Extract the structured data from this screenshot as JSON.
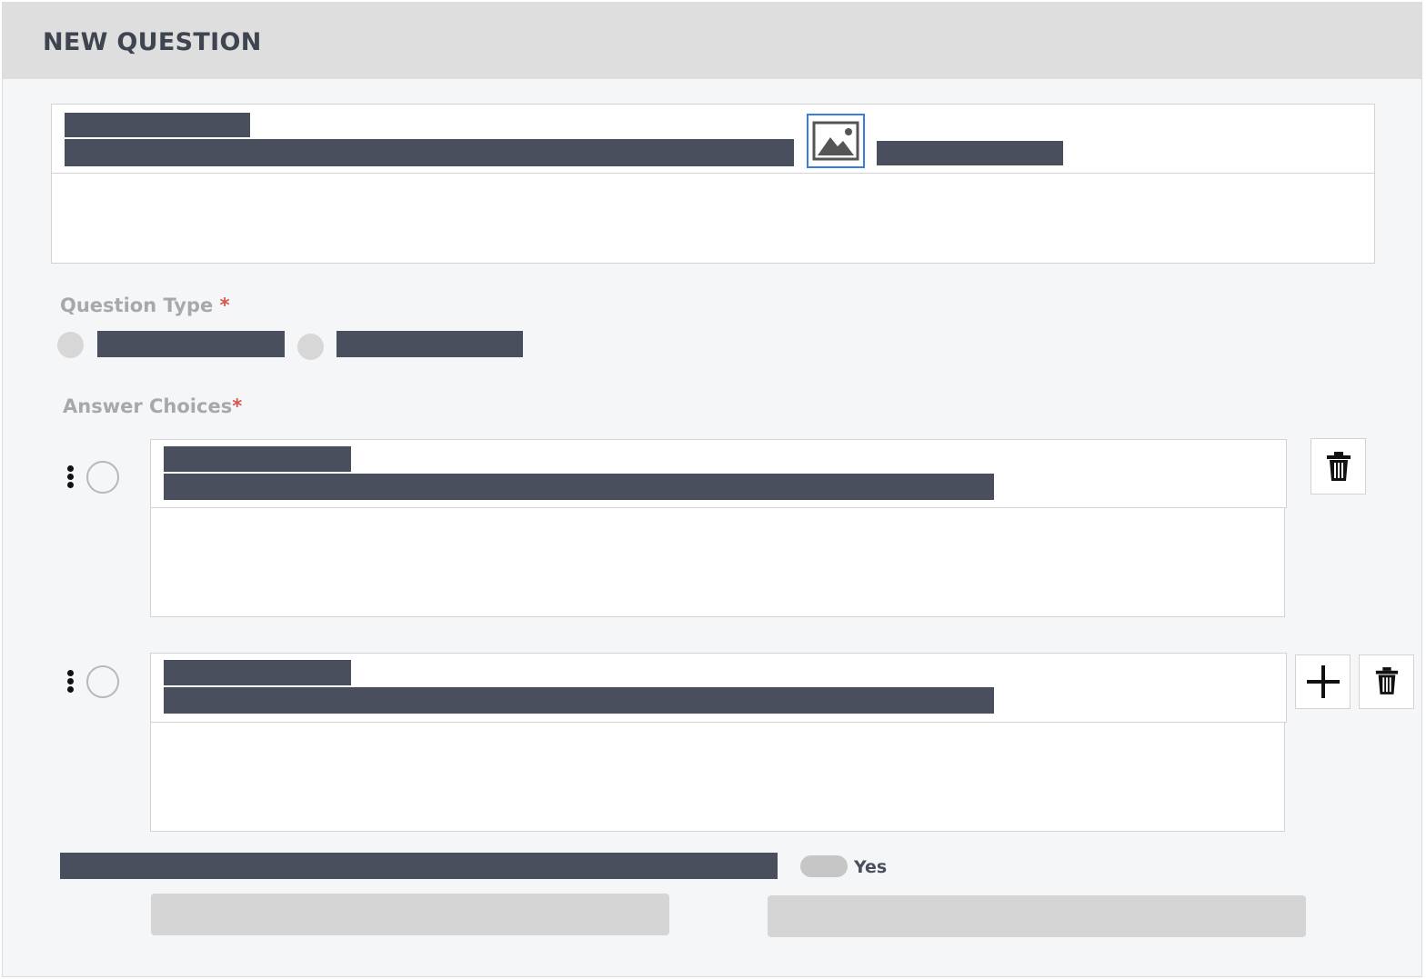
{
  "header": {
    "title": "NEW QUESTION"
  },
  "question": {
    "type_label": "Question Type",
    "required_mark": "*",
    "image_icon": "image-icon"
  },
  "answers": {
    "label": "Answer Choices",
    "required_mark": "*",
    "items": [
      {
        "drag_icon": "kebab-icon",
        "delete_icon": "trash-icon"
      },
      {
        "drag_icon": "kebab-icon",
        "add_icon": "plus-icon",
        "delete_icon": "trash-icon"
      }
    ]
  },
  "toggle": {
    "label": "Yes",
    "state": "off"
  },
  "colors": {
    "accent": "#3b7ddd",
    "required": "#d9534f",
    "redacted": "#4a4f5e",
    "header_bg": "#dedede",
    "panel_bg": "#f5f6f8"
  }
}
